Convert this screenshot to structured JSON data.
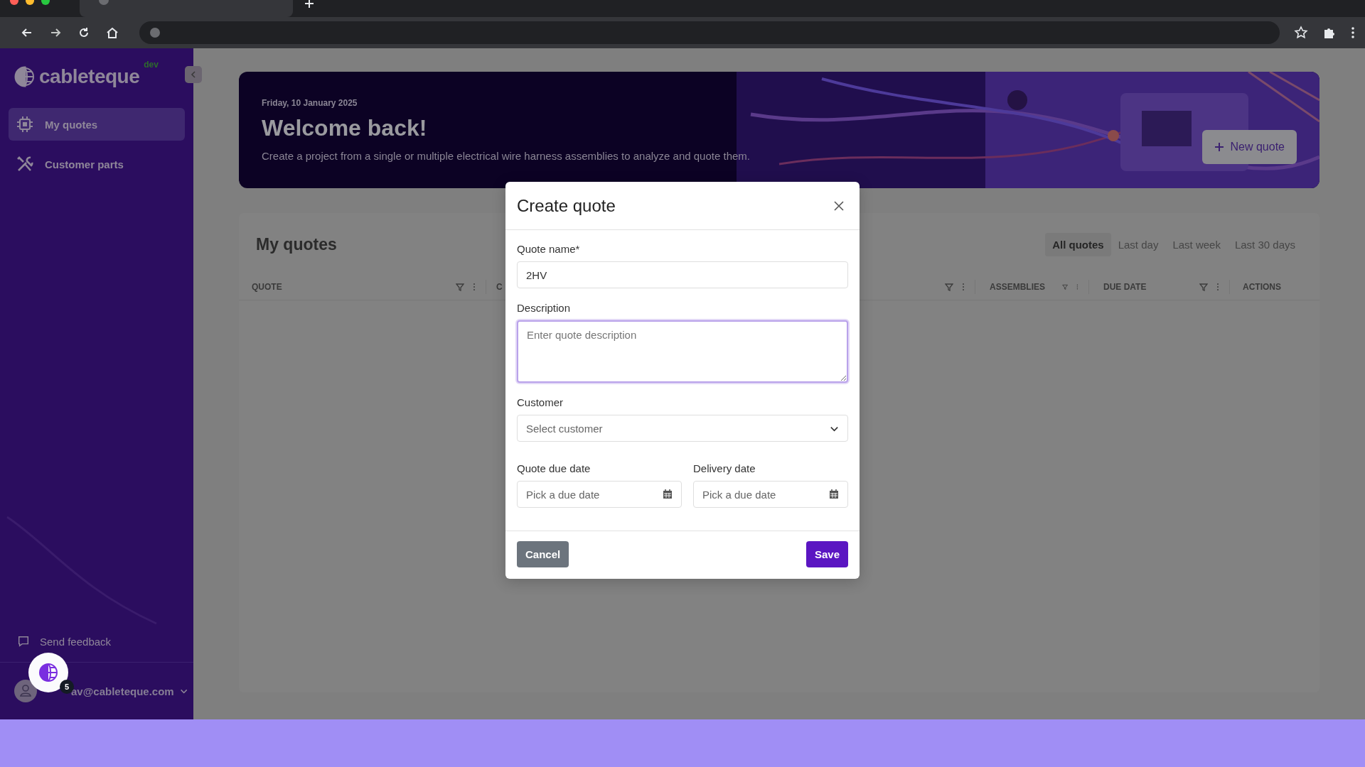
{
  "sidebar": {
    "logo": "cableteque",
    "env_badge": "dev",
    "items": [
      {
        "label": "My quotes",
        "selected": true
      },
      {
        "label": "Customer parts",
        "selected": false
      }
    ],
    "feedback": "Send feedback",
    "user_email": "av@cableteque.com",
    "notification_count": "5"
  },
  "banner": {
    "date": "Friday, 10 January 2025",
    "title": "Welcome back!",
    "subtitle": "Create a project from a single or multiple electrical wire harness assemblies to analyze and quote them.",
    "button": "New quote"
  },
  "quotes": {
    "title": "My quotes",
    "filters": [
      {
        "label": "All quotes",
        "selected": true
      },
      {
        "label": "Last day",
        "selected": false
      },
      {
        "label": "Last week",
        "selected": false
      },
      {
        "label": "Last 30 days",
        "selected": false
      }
    ],
    "columns": [
      {
        "label": "QUOTE",
        "kind": "filterable"
      },
      {
        "label": "C",
        "kind": "cut"
      },
      {
        "kind": "covered"
      },
      {
        "label": "ASSEMBLIES",
        "kind": "filterable"
      },
      {
        "label": "DUE DATE",
        "kind": "filterable"
      },
      {
        "label": "ACTIONS",
        "kind": "actions"
      }
    ]
  },
  "modal": {
    "title": "Create quote",
    "fields": [
      {
        "label": "Quote name*",
        "value": "2HV",
        "kind": "text",
        "focused": false
      },
      {
        "label": "Description",
        "placeholder": "Enter quote description",
        "kind": "textarea",
        "focused": true
      },
      {
        "label": "Customer",
        "placeholder": "Select customer",
        "kind": "select",
        "focused": false
      }
    ],
    "date_fields": [
      {
        "label": "Quote due date",
        "placeholder": "Pick a due date"
      },
      {
        "label": "Delivery date",
        "placeholder": "Pick a due date"
      }
    ],
    "buttons": [
      {
        "label": "Cancel",
        "kind": "secondary"
      },
      {
        "label": "Save",
        "kind": "primary"
      }
    ]
  }
}
